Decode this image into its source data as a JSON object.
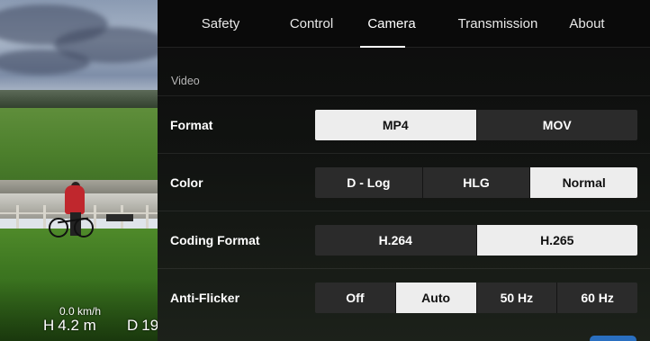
{
  "telemetry": {
    "speed": "0.0 km/h",
    "height_key": "H",
    "height_value": "4.2 m",
    "distance_key": "D",
    "distance_value": "19"
  },
  "tabs": [
    {
      "label": "Safety",
      "active": false
    },
    {
      "label": "Control",
      "active": false
    },
    {
      "label": "Camera",
      "active": true
    },
    {
      "label": "Transmission",
      "active": false
    },
    {
      "label": "About",
      "active": false
    }
  ],
  "section_title": "Video",
  "settings": {
    "format": {
      "label": "Format",
      "options": [
        "MP4",
        "MOV"
      ],
      "selected": "MP4"
    },
    "color": {
      "label": "Color",
      "options": [
        "D - Log",
        "HLG",
        "Normal"
      ],
      "selected": "Normal"
    },
    "coding_format": {
      "label": "Coding Format",
      "options": [
        "H.264",
        "H.265"
      ],
      "selected": "H.265"
    },
    "anti_flicker": {
      "label": "Anti-Flicker",
      "options": [
        "Off",
        "Auto",
        "50 Hz",
        "60 Hz"
      ],
      "selected": "Auto"
    }
  },
  "colors": {
    "selected_bg": "#ededed",
    "unselected_bg": "#2b2b2b",
    "accent": "#2a6fc0"
  }
}
